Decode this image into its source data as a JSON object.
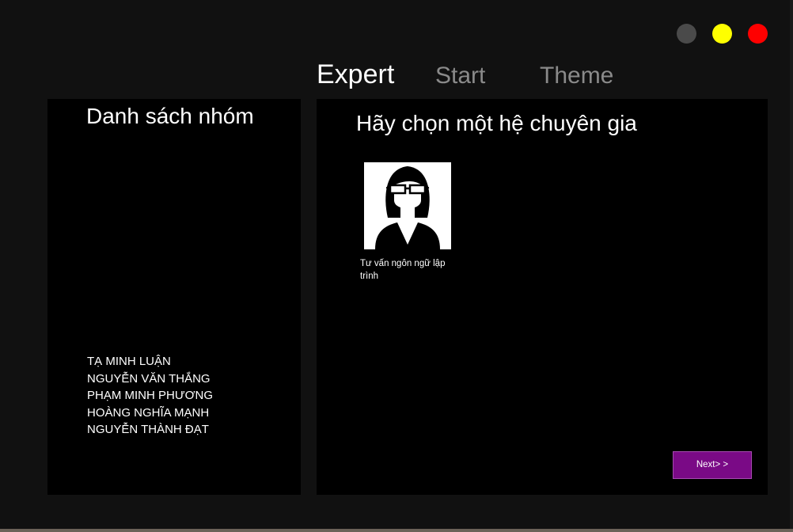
{
  "window_controls": {
    "minimize_color": "#4a4a4a",
    "maximize_color": "#ffff00",
    "close_color": "#ff0000"
  },
  "tabs": [
    {
      "label": "Expert",
      "active": true
    },
    {
      "label": "Start",
      "active": false
    },
    {
      "label": "Theme",
      "active": false
    }
  ],
  "left_panel": {
    "title": "Danh sách nhóm",
    "members": [
      "TẠ MINH LUẬN",
      "NGUYỄN VĂN THẮNG",
      "PHẠM MINH PHƯƠNG",
      "HOÀNG NGHĨA MẠNH",
      "NGUYỄN THÀNH ĐẠT"
    ]
  },
  "right_panel": {
    "title": "Hãy chọn một hệ chuyên gia",
    "experts": [
      {
        "label": "Tư vấn ngôn ngữ lập trình",
        "icon": "woman-with-glasses-avatar-icon"
      }
    ],
    "next_label": "Next> >",
    "next_color": "#7a0a86"
  }
}
